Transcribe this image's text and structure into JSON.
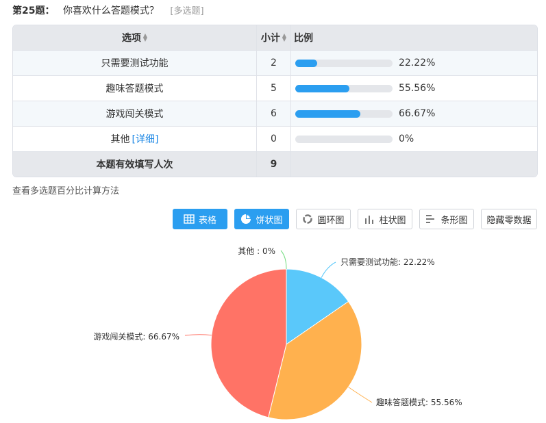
{
  "question": {
    "number": "第25题：",
    "text": "你喜欢什么答题模式？",
    "tag": "[多选题]"
  },
  "table": {
    "headers": {
      "option": "选项",
      "count": "小计",
      "ratio": "比例"
    },
    "rows": [
      {
        "label": "只需要测试功能",
        "count": "2",
        "percent": "22.22%",
        "value": 22.22
      },
      {
        "label": "趣味答题模式",
        "count": "5",
        "percent": "55.56%",
        "value": 55.56
      },
      {
        "label": "游戏闯关模式",
        "count": "6",
        "percent": "66.67%",
        "value": 66.67
      },
      {
        "label": "其他",
        "detail": "[详细]",
        "count": "0",
        "percent": "0%",
        "value": 0
      }
    ],
    "footer": {
      "label": "本题有效填写人次",
      "count": "9"
    }
  },
  "method_link": "查看多选题百分比计算方法",
  "toolbar": {
    "table": "表格",
    "pie": "饼状图",
    "donut": "圆环图",
    "column": "柱状图",
    "bar": "条形图",
    "hide_zero": "隐藏零数据"
  },
  "chart_data": {
    "type": "pie",
    "slices": [
      {
        "label": "只需要测试功能: 22.22%",
        "value": 2,
        "color": "#5ac8fa"
      },
      {
        "label": "趣味答题模式: 55.56%",
        "value": 5,
        "color": "#ffb14e"
      },
      {
        "label": "游戏闯关模式: 66.67%",
        "value": 6,
        "color": "#ff7366"
      },
      {
        "label": "其他 : 0%",
        "value": 0,
        "color": "#6fdc7c"
      }
    ]
  },
  "colors": {
    "accent": "#2b9ef0",
    "link": "#1e88e5"
  }
}
